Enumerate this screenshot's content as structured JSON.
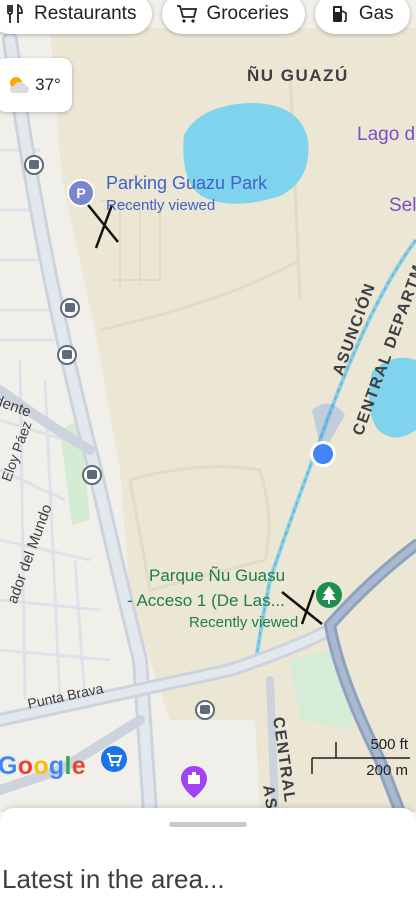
{
  "chips": [
    {
      "label": "Restaurants",
      "icon": "fork-knife-icon"
    },
    {
      "label": "Groceries",
      "icon": "shopping-cart-icon"
    },
    {
      "label": "Gas",
      "icon": "gas-pump-icon"
    }
  ],
  "weather": {
    "temp": "37°",
    "icon": "partly-cloudy-icon"
  },
  "map": {
    "area_label": "ÑU GUAZÚ",
    "lago_label": "Lago d",
    "sel_label": "Sel",
    "asuncion_label": "ASUNCIÓN",
    "central_dept_label": "CENTRAL DEPARTM",
    "central_bottom_label": "CENTRAL D",
    "asu_bottom_label": "ASU",
    "road_dente": "dente",
    "road_eloy": "Eloy Páez",
    "road_mundo": "ador del Mundo",
    "road_punta": "Punta Brava",
    "parking": {
      "title": "Parking Guazu Park",
      "subtitle": "Recently viewed",
      "icon": "parking-icon"
    },
    "park": {
      "title_line1": "Parque Ñu Guasu",
      "title_line2": "- Acceso 1 (De Las...",
      "subtitle": "Recently viewed",
      "icon": "tree-icon"
    },
    "scale": {
      "imperial": "500 ft",
      "metric": "200 m"
    },
    "attribution": "Google",
    "colors": {
      "land": "#f1efe9",
      "park": "#ebe6d6",
      "water": "#7fd3ed",
      "road": "#ccd3dd",
      "major_road": "#8ea2bd",
      "location": "#4285f4"
    }
  },
  "sheet": {
    "title": "Latest in the area..."
  }
}
